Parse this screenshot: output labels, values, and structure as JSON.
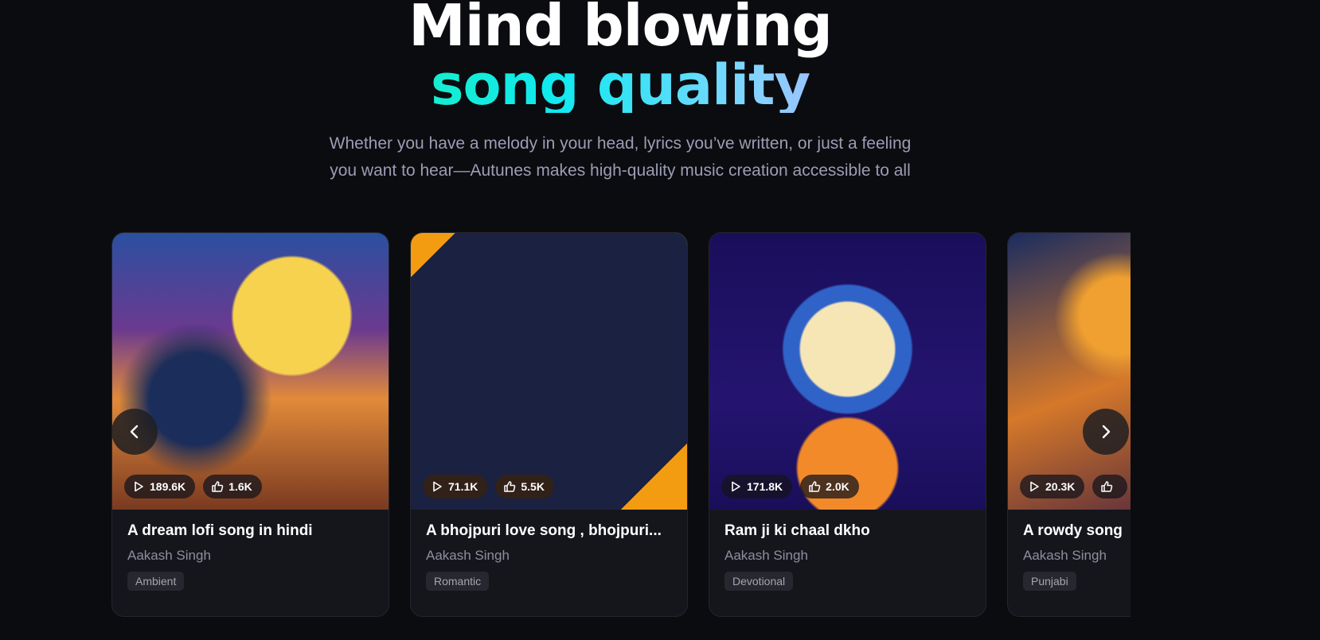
{
  "hero": {
    "title_line1": "Mind blowing",
    "title_line2": "song quality",
    "subtitle_line1": "Whether you have a melody in your head, lyrics you’ve written, or just a feeling",
    "subtitle_line2": "you want to hear—Autunes makes high-quality music creation accessible to all"
  },
  "carousel": {
    "prev_icon": "chevron-left-icon",
    "next_icon": "chevron-right-icon",
    "cards": [
      {
        "title": "A dream lofi song in hindi",
        "artist": "Aakash Singh",
        "tag": "Ambient",
        "plays": "189.6K",
        "likes": "1.6K"
      },
      {
        "title": "A bhojpuri love song , bhojpuri...",
        "artist": "Aakash Singh",
        "tag": "Romantic",
        "plays": "71.1K",
        "likes": "5.5K"
      },
      {
        "title": "Ram ji ki chaal dkho",
        "artist": "Aakash Singh",
        "tag": "Devotional",
        "plays": "171.8K",
        "likes": "2.0K"
      },
      {
        "title": "A rowdy song",
        "artist": "Aakash Singh",
        "tag": "Punjabi",
        "plays": "20.3K",
        "likes": ""
      }
    ]
  }
}
